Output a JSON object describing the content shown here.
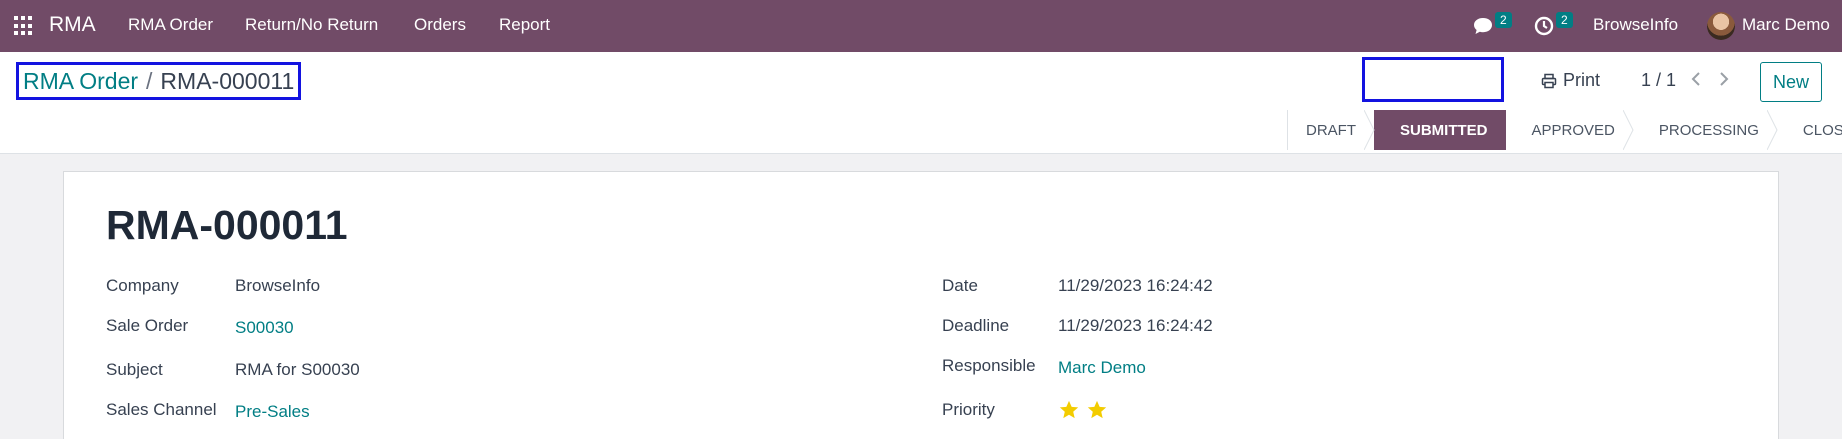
{
  "navbar": {
    "brand": "RMA",
    "menu": [
      "RMA Order",
      "Return/No Return",
      "Orders",
      "Report"
    ],
    "messages_count": "2",
    "activities_count": "2",
    "company": "BrowseInfo",
    "user": "Marc Demo"
  },
  "breadcrumb": {
    "parent": "RMA Order",
    "separator": "/",
    "current": "RMA-000011"
  },
  "control": {
    "print_label": "Print",
    "pager": "1 / 1",
    "new_label": "New"
  },
  "statusbar": {
    "stages": [
      "DRAFT",
      "SUBMITTED",
      "APPROVED",
      "PROCESSING",
      "CLOSED"
    ],
    "active": "SUBMITTED"
  },
  "form": {
    "title": "RMA-000011",
    "left_fields": [
      {
        "label": "Company",
        "value": "BrowseInfo"
      },
      {
        "label": "Sale Order",
        "value": "S00030"
      },
      {
        "label": "Subject",
        "value": "RMA for S00030"
      },
      {
        "label": "Sales Channel",
        "value": "Pre-Sales"
      }
    ],
    "right_fields": [
      {
        "label": "Date",
        "value": "11/29/2023 16:24:42"
      },
      {
        "label": "Deadline",
        "value": "11/29/2023 16:24:42"
      },
      {
        "label": "Responsible",
        "value": "Marc Demo"
      },
      {
        "label": "Priority",
        "value": "2"
      }
    ]
  },
  "colors": {
    "brand": "#714B67",
    "link": "#017e84",
    "highlight": "#1313e0",
    "star": "#f3cc00"
  },
  "icons": [
    "apps-grid-icon",
    "chat-icon",
    "clock-icon",
    "printer-icon",
    "chevron-left-icon",
    "chevron-right-icon",
    "star-icon"
  ]
}
